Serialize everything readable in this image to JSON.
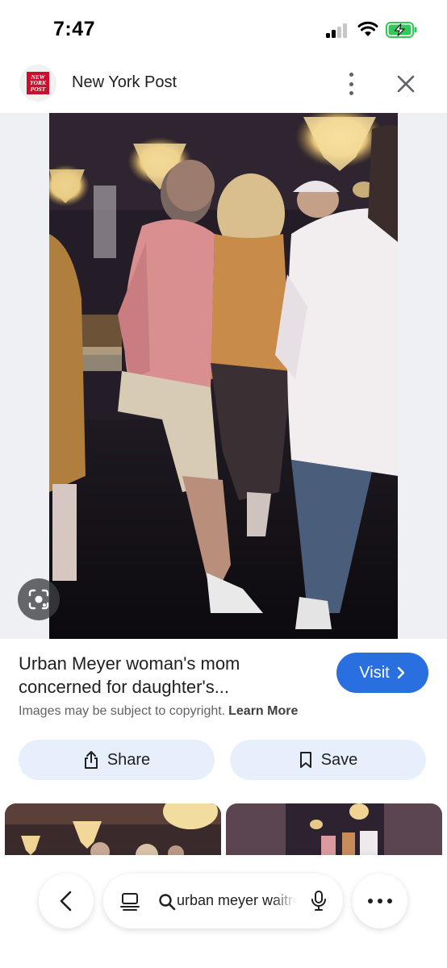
{
  "status_bar": {
    "time": "7:47"
  },
  "source": {
    "name": "New York Post",
    "logo_text": [
      "NEW",
      "YORK",
      "POST"
    ],
    "logo_color": "#c8102e"
  },
  "result": {
    "title": "Urban Meyer woman's mom concerned for daughter's...",
    "visit_label": "Visit",
    "copyright_notice": "Images may be subject to copyright.",
    "learn_more_label": "Learn More"
  },
  "actions": {
    "share_label": "Share",
    "save_label": "Save"
  },
  "search": {
    "query": "urban meyer waitress video"
  },
  "colors": {
    "accent": "#2a6fe0",
    "action_bg": "#e8effc",
    "image_bg": "#eef0f3"
  },
  "icons": [
    "cellular-signal-icon",
    "wifi-icon",
    "battery-charging-icon",
    "more-vert-icon",
    "close-icon",
    "lens-icon",
    "chevron-right-icon",
    "share-icon",
    "bookmark-icon",
    "back-arrow-icon",
    "tabs-icon",
    "search-icon",
    "mic-icon",
    "more-horiz-icon"
  ]
}
